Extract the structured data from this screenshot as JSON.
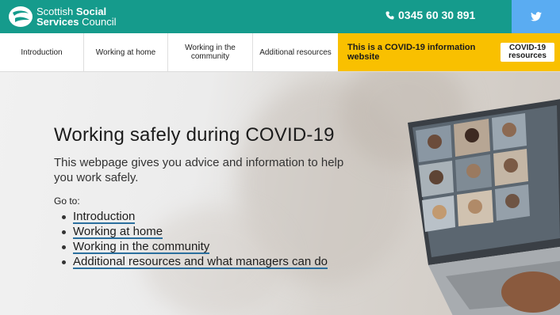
{
  "header": {
    "logo_line1_a": "Scottish ",
    "logo_line1_b": "Social",
    "logo_line2_a": "Services ",
    "logo_line2_b": "Council",
    "phone": "0345 60 30 891",
    "colors": {
      "bar": "#159b8c",
      "twitter": "#5aacf2"
    }
  },
  "nav": {
    "items": [
      {
        "label": "Introduction"
      },
      {
        "label": "Working at home"
      },
      {
        "label": "Working in the community"
      },
      {
        "label": "Additional resources"
      }
    ],
    "covid_text": "This is a COVID-19 information website",
    "covid_button": "COVID-19 resources",
    "covid_color": "#f9c000"
  },
  "hero": {
    "title": "Working safely during COVID-19",
    "intro": "This webpage gives you advice and information to help you work safely.",
    "goto": "Go to:",
    "links": [
      "Introduction",
      "Working at home",
      "Working in the community",
      "Additional resources and what managers can do"
    ]
  }
}
